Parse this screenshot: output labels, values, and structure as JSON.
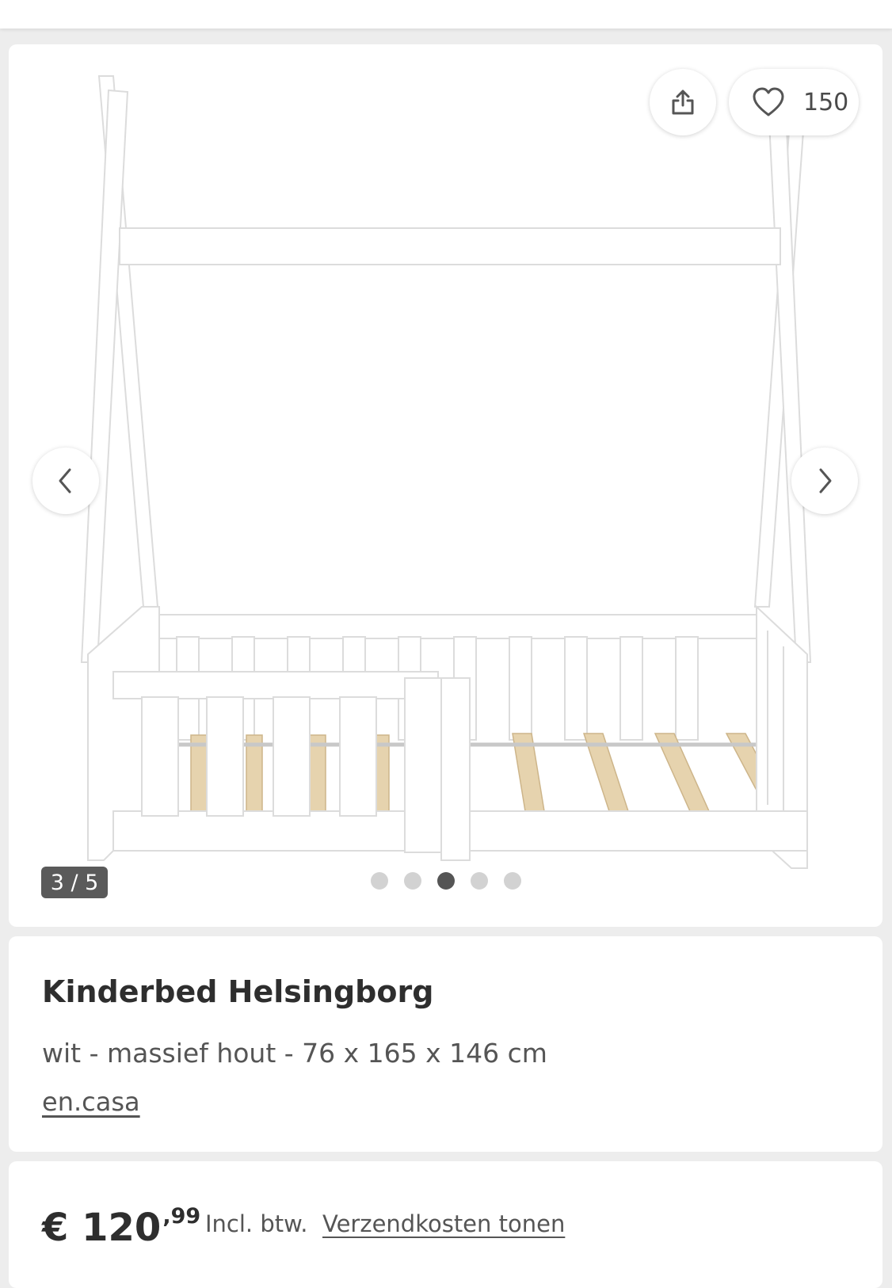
{
  "gallery": {
    "favorite_count": "150",
    "image_counter": "3 / 5",
    "total_images": 5,
    "active_image": 3,
    "icons": [
      "share-icon",
      "heart-icon",
      "chevron-left-icon",
      "chevron-right-icon"
    ]
  },
  "product": {
    "title": "Kinderbed Helsingborg",
    "subtitle": "wit - massief hout - 76 x 165 x 146 cm",
    "brand": "en.casa"
  },
  "pricing": {
    "currency": "€",
    "whole": "120",
    "cents": ",99",
    "vat_note": "Incl. btw.",
    "shipping_link": "Verzendkosten tonen"
  },
  "colors": {
    "background": "#ededed",
    "card": "#ffffff",
    "text": "#2e2e2e",
    "badge": "#5a5a5a",
    "wood": "#e6d3ae"
  }
}
